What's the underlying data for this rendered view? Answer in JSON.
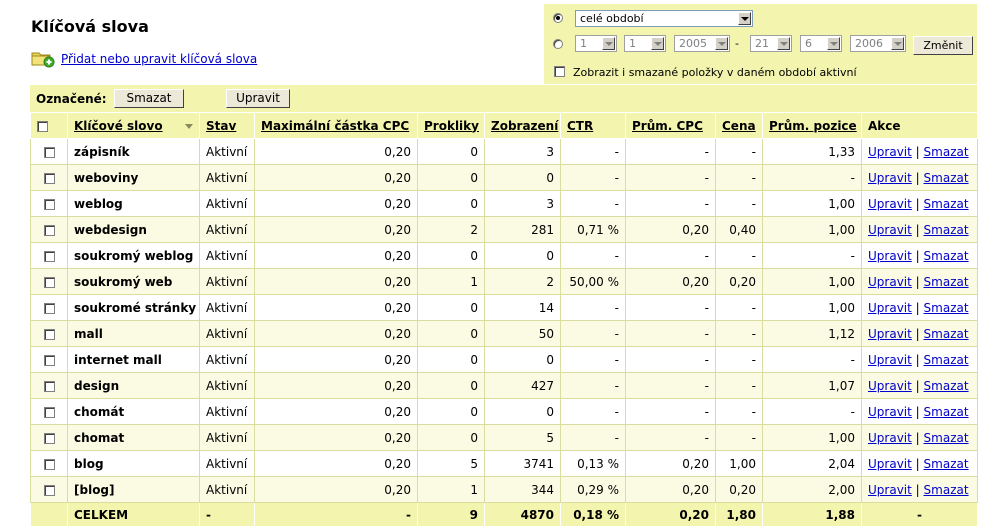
{
  "title": "Klíčová slova",
  "add_link": "Přidat nebo upravit klíčová slova",
  "period": {
    "whole_period": "celé období",
    "from_day": "1",
    "from_month": "1",
    "from_year": "2005",
    "dash": "-",
    "to_day": "21",
    "to_month": "6",
    "to_year": "2006",
    "change_button": "Změnit",
    "show_deleted_label": "Zobrazit i smazané položky v daném období aktivní"
  },
  "marked": {
    "label": "Označené:",
    "delete_button": "Smazat",
    "edit_button": "Upravit"
  },
  "columns": {
    "keyword": "Klíčové slovo",
    "status": "Stav",
    "max_cpc": "Maximální částka CPC",
    "clicks": "Prokliky",
    "impressions": "Zobrazení",
    "ctr": "CTR",
    "avg_cpc": "Prům. CPC",
    "cost": "Cena",
    "avg_position": "Prům. pozice",
    "actions": "Akce"
  },
  "action_edit": "Upravit",
  "action_sep": "|",
  "action_delete": "Smazat",
  "rows": [
    {
      "keyword": "zápisník",
      "status": "Aktivní",
      "max_cpc": "0,20",
      "clicks": "0",
      "impressions": "3",
      "ctr": "-",
      "avg_cpc": "-",
      "cost": "-",
      "avg_position": "1,33"
    },
    {
      "keyword": "weboviny",
      "status": "Aktivní",
      "max_cpc": "0,20",
      "clicks": "0",
      "impressions": "0",
      "ctr": "-",
      "avg_cpc": "-",
      "cost": "-",
      "avg_position": "-"
    },
    {
      "keyword": "weblog",
      "status": "Aktivní",
      "max_cpc": "0,20",
      "clicks": "0",
      "impressions": "3",
      "ctr": "-",
      "avg_cpc": "-",
      "cost": "-",
      "avg_position": "1,00"
    },
    {
      "keyword": "webdesign",
      "status": "Aktivní",
      "max_cpc": "0,20",
      "clicks": "2",
      "impressions": "281",
      "ctr": "0,71 %",
      "avg_cpc": "0,20",
      "cost": "0,40",
      "avg_position": "1,00"
    },
    {
      "keyword": "soukromý weblog",
      "status": "Aktivní",
      "max_cpc": "0,20",
      "clicks": "0",
      "impressions": "0",
      "ctr": "-",
      "avg_cpc": "-",
      "cost": "-",
      "avg_position": "-"
    },
    {
      "keyword": "soukromý web",
      "status": "Aktivní",
      "max_cpc": "0,20",
      "clicks": "1",
      "impressions": "2",
      "ctr": "50,00 %",
      "avg_cpc": "0,20",
      "cost": "0,20",
      "avg_position": "1,00"
    },
    {
      "keyword": "soukromé stránky",
      "status": "Aktivní",
      "max_cpc": "0,20",
      "clicks": "0",
      "impressions": "14",
      "ctr": "-",
      "avg_cpc": "-",
      "cost": "-",
      "avg_position": "1,00"
    },
    {
      "keyword": "mall",
      "status": "Aktivní",
      "max_cpc": "0,20",
      "clicks": "0",
      "impressions": "50",
      "ctr": "-",
      "avg_cpc": "-",
      "cost": "-",
      "avg_position": "1,12"
    },
    {
      "keyword": "internet mall",
      "status": "Aktivní",
      "max_cpc": "0,20",
      "clicks": "0",
      "impressions": "0",
      "ctr": "-",
      "avg_cpc": "-",
      "cost": "-",
      "avg_position": "-"
    },
    {
      "keyword": "design",
      "status": "Aktivní",
      "max_cpc": "0,20",
      "clicks": "0",
      "impressions": "427",
      "ctr": "-",
      "avg_cpc": "-",
      "cost": "-",
      "avg_position": "1,07"
    },
    {
      "keyword": "chomát",
      "status": "Aktivní",
      "max_cpc": "0,20",
      "clicks": "0",
      "impressions": "0",
      "ctr": "-",
      "avg_cpc": "-",
      "cost": "-",
      "avg_position": "-"
    },
    {
      "keyword": "chomat",
      "status": "Aktivní",
      "max_cpc": "0,20",
      "clicks": "0",
      "impressions": "5",
      "ctr": "-",
      "avg_cpc": "-",
      "cost": "-",
      "avg_position": "1,00"
    },
    {
      "keyword": "blog",
      "status": "Aktivní",
      "max_cpc": "0,20",
      "clicks": "5",
      "impressions": "3741",
      "ctr": "0,13 %",
      "avg_cpc": "0,20",
      "cost": "1,00",
      "avg_position": "2,04"
    },
    {
      "keyword": "[blog]",
      "status": "Aktivní",
      "max_cpc": "0,20",
      "clicks": "1",
      "impressions": "344",
      "ctr": "0,29 %",
      "avg_cpc": "0,20",
      "cost": "0,20",
      "avg_position": "2,00"
    }
  ],
  "total": {
    "label": "CELKEM",
    "status": "-",
    "max_cpc": "-",
    "clicks": "9",
    "impressions": "4870",
    "ctr": "0,18 %",
    "avg_cpc": "0,20",
    "cost": "1,80",
    "avg_position": "1,88",
    "actions": "-"
  },
  "icons": {
    "add": "folder-add-icon",
    "sort": "sort-desc-icon"
  },
  "colors": {
    "panel": "#f3f5ae",
    "row_alt": "#fbfbe3",
    "link": "#0000cc"
  }
}
